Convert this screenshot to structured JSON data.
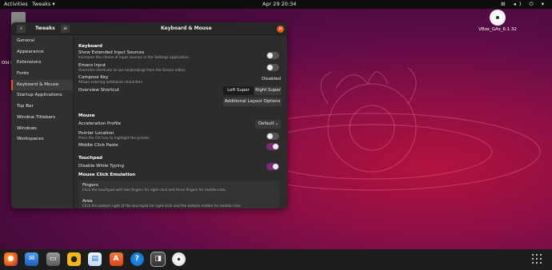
{
  "topbar": {
    "activities": "Activities",
    "app": "Tweaks",
    "clock": "Apr 29  20:34"
  },
  "desktop": {
    "disc_label": "VBox_GAs_6.1.32",
    "partial_label": "Old F"
  },
  "window": {
    "sidebar_title": "Tweaks",
    "main_title": "Keyboard & Mouse",
    "sidebar": [
      "General",
      "Appearance",
      "Extensions",
      "Fonts",
      "Keyboard & Mouse",
      "Startup Applications",
      "Top Bar",
      "Window Titlebars",
      "Windows",
      "Workspaces"
    ],
    "active_index": 4
  },
  "content": {
    "keyboard": {
      "title": "Keyboard",
      "show_ext": "Show Extended Input Sources",
      "show_ext_desc": "Increases the choice of input sources in the Settings application.",
      "emacs": "Emacs Input",
      "emacs_desc": "Overrides shortcuts to use keybindings from the Emacs editor.",
      "compose": "Compose Key",
      "compose_value": "Disabled",
      "compose_desc": "Allows entering additional characters.",
      "overview": "Overview Shortcut",
      "left_super": "Left Super",
      "right_super": "Right Super",
      "additional": "Additional Layout Options"
    },
    "mouse": {
      "title": "Mouse",
      "accel": "Acceleration Profile",
      "accel_value": "Default",
      "pointer": "Pointer Location",
      "pointer_desc": "Press the Ctrl key to highlight the pointer.",
      "middle": "Middle Click Paste"
    },
    "touchpad": {
      "title": "Touchpad",
      "disable_typing": "Disable While Typing",
      "emulation": "Mouse Click Emulation",
      "fingers": "Fingers",
      "fingers_desc": "Click the touchpad with two fingers for right-click and three fingers for middle-click.",
      "area": "Area",
      "area_desc": "Click the bottom right of the touchpad for right-click and the bottom middle for middle-click."
    }
  },
  "toggles": {
    "show_ext": false,
    "emacs": false,
    "pointer": false,
    "middle": true,
    "disable_typing": true
  },
  "colors": {
    "accent": "#e95420",
    "toggle_on": "#7a2b74"
  },
  "dock": [
    "firefox-icon",
    "thunderbird-icon",
    "files-icon",
    "rhythmbox-icon",
    "libreoffice-writer-icon",
    "app-center-icon",
    "help-icon",
    "tweaks-icon",
    "disc-icon"
  ]
}
